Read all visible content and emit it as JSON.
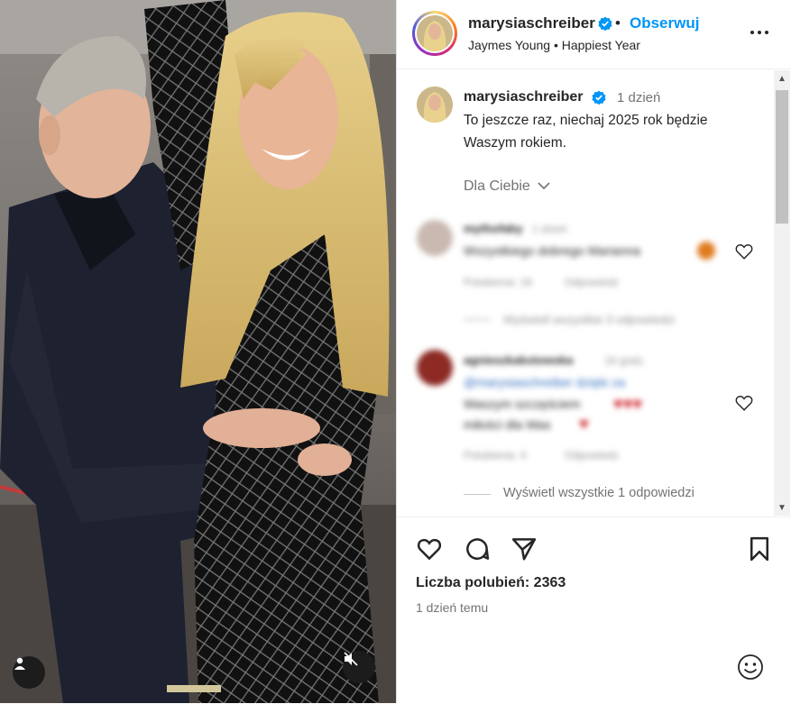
{
  "post": {
    "username": "marysiaschreiber",
    "follow_label": "Obserwuj",
    "separator": "•",
    "audio": "Jaymes Young • Happiest Year",
    "more_icon": "more-horizontal-icon"
  },
  "caption": {
    "username": "marysiaschreiber",
    "time": "1 dzień",
    "text": "To jeszcze raz, niechaj 2025 rok będzie Waszym rokiem.",
    "for_you_label": "Dla Ciebie"
  },
  "comments": [
    {
      "username": "mythofaby",
      "time": "1 dzień",
      "text": "Wszystkiego dobrego Marianna",
      "meta_likes": "Polubienia: 16",
      "meta_reply": "Odpowiedz",
      "view_replies": "Wyświetl wszystkie 3 odpowiedzi"
    },
    {
      "username": "agnieszkakotowska",
      "time": "16 godz.",
      "text_line1": "@marysiaschreiber dzięki za",
      "text_line2": "Waszym szczęściem",
      "text_line3": "miłości dla Was",
      "meta_likes": "Polubienia: 4",
      "meta_reply": "Odpowiedz"
    }
  ],
  "view_all_replies": "Wyświetl wszystkie 1 odpowiedzi",
  "actions": {
    "likes": "Liczba polubień: 2363",
    "time_ago": "1 dzień temu"
  },
  "colors": {
    "accent": "#0095f6",
    "verified": "#0095f6",
    "text": "#262626",
    "muted": "#737373"
  }
}
